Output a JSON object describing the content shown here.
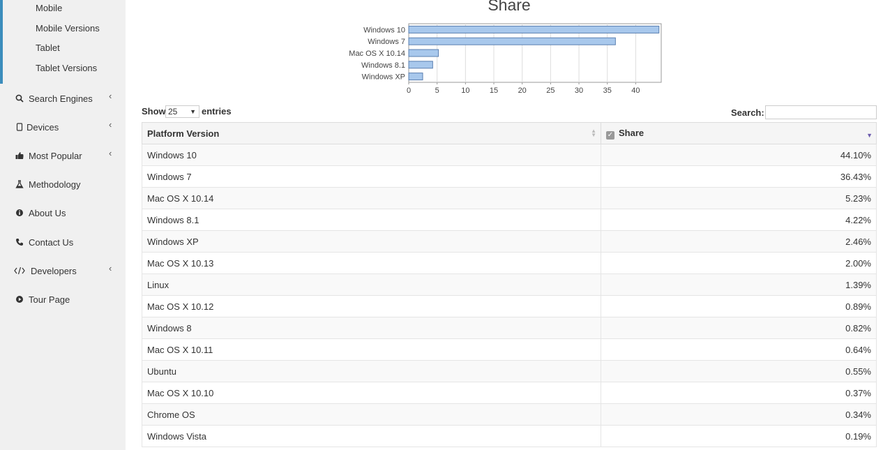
{
  "sidebar": {
    "sub_items": [
      "Mobile",
      "Mobile Versions",
      "Tablet",
      "Tablet Versions"
    ],
    "nav": [
      {
        "label": "Search Engines",
        "icon": "search-icon",
        "chevron": true
      },
      {
        "label": "Devices",
        "icon": "device-icon",
        "chevron": true
      },
      {
        "label": "Most Popular",
        "icon": "thumbs-up-icon",
        "chevron": true
      },
      {
        "label": "Methodology",
        "icon": "flask-icon",
        "chevron": false
      },
      {
        "label": "About Us",
        "icon": "info-icon",
        "chevron": false
      },
      {
        "label": "Contact Us",
        "icon": "phone-icon",
        "chevron": false
      },
      {
        "label": "Developers",
        "icon": "code-icon",
        "chevron": true
      },
      {
        "label": "Tour Page",
        "icon": "play-circle-icon",
        "chevron": false
      }
    ]
  },
  "chart_data": {
    "type": "bar",
    "title": "Share",
    "categories": [
      "Windows 10",
      "Windows 7",
      "Mac OS X 10.14",
      "Windows 8.1",
      "Windows XP"
    ],
    "values": [
      44.1,
      36.43,
      5.23,
      4.22,
      2.46
    ],
    "xlim": [
      0,
      44.5
    ],
    "xticks": [
      0,
      5,
      10,
      15,
      20,
      25,
      30,
      35,
      40
    ],
    "orientation": "horizontal",
    "grid": true,
    "bar_color": "#a8c8ec"
  },
  "table_controls": {
    "show_label": "Show",
    "length_value": "25",
    "entries_label": "entries",
    "search_label": "Search:",
    "search_value": ""
  },
  "table": {
    "headers": [
      "Platform Version",
      "Share"
    ],
    "rows": [
      [
        "Windows 10",
        "44.10%"
      ],
      [
        "Windows 7",
        "36.43%"
      ],
      [
        "Mac OS X 10.14",
        "5.23%"
      ],
      [
        "Windows 8.1",
        "4.22%"
      ],
      [
        "Windows XP",
        "2.46%"
      ],
      [
        "Mac OS X 10.13",
        "2.00%"
      ],
      [
        "Linux",
        "1.39%"
      ],
      [
        "Mac OS X 10.12",
        "0.89%"
      ],
      [
        "Windows 8",
        "0.82%"
      ],
      [
        "Mac OS X 10.11",
        "0.64%"
      ],
      [
        "Ubuntu",
        "0.55%"
      ],
      [
        "Mac OS X 10.10",
        "0.37%"
      ],
      [
        "Chrome OS",
        "0.34%"
      ],
      [
        "Windows Vista",
        "0.19%"
      ]
    ]
  }
}
